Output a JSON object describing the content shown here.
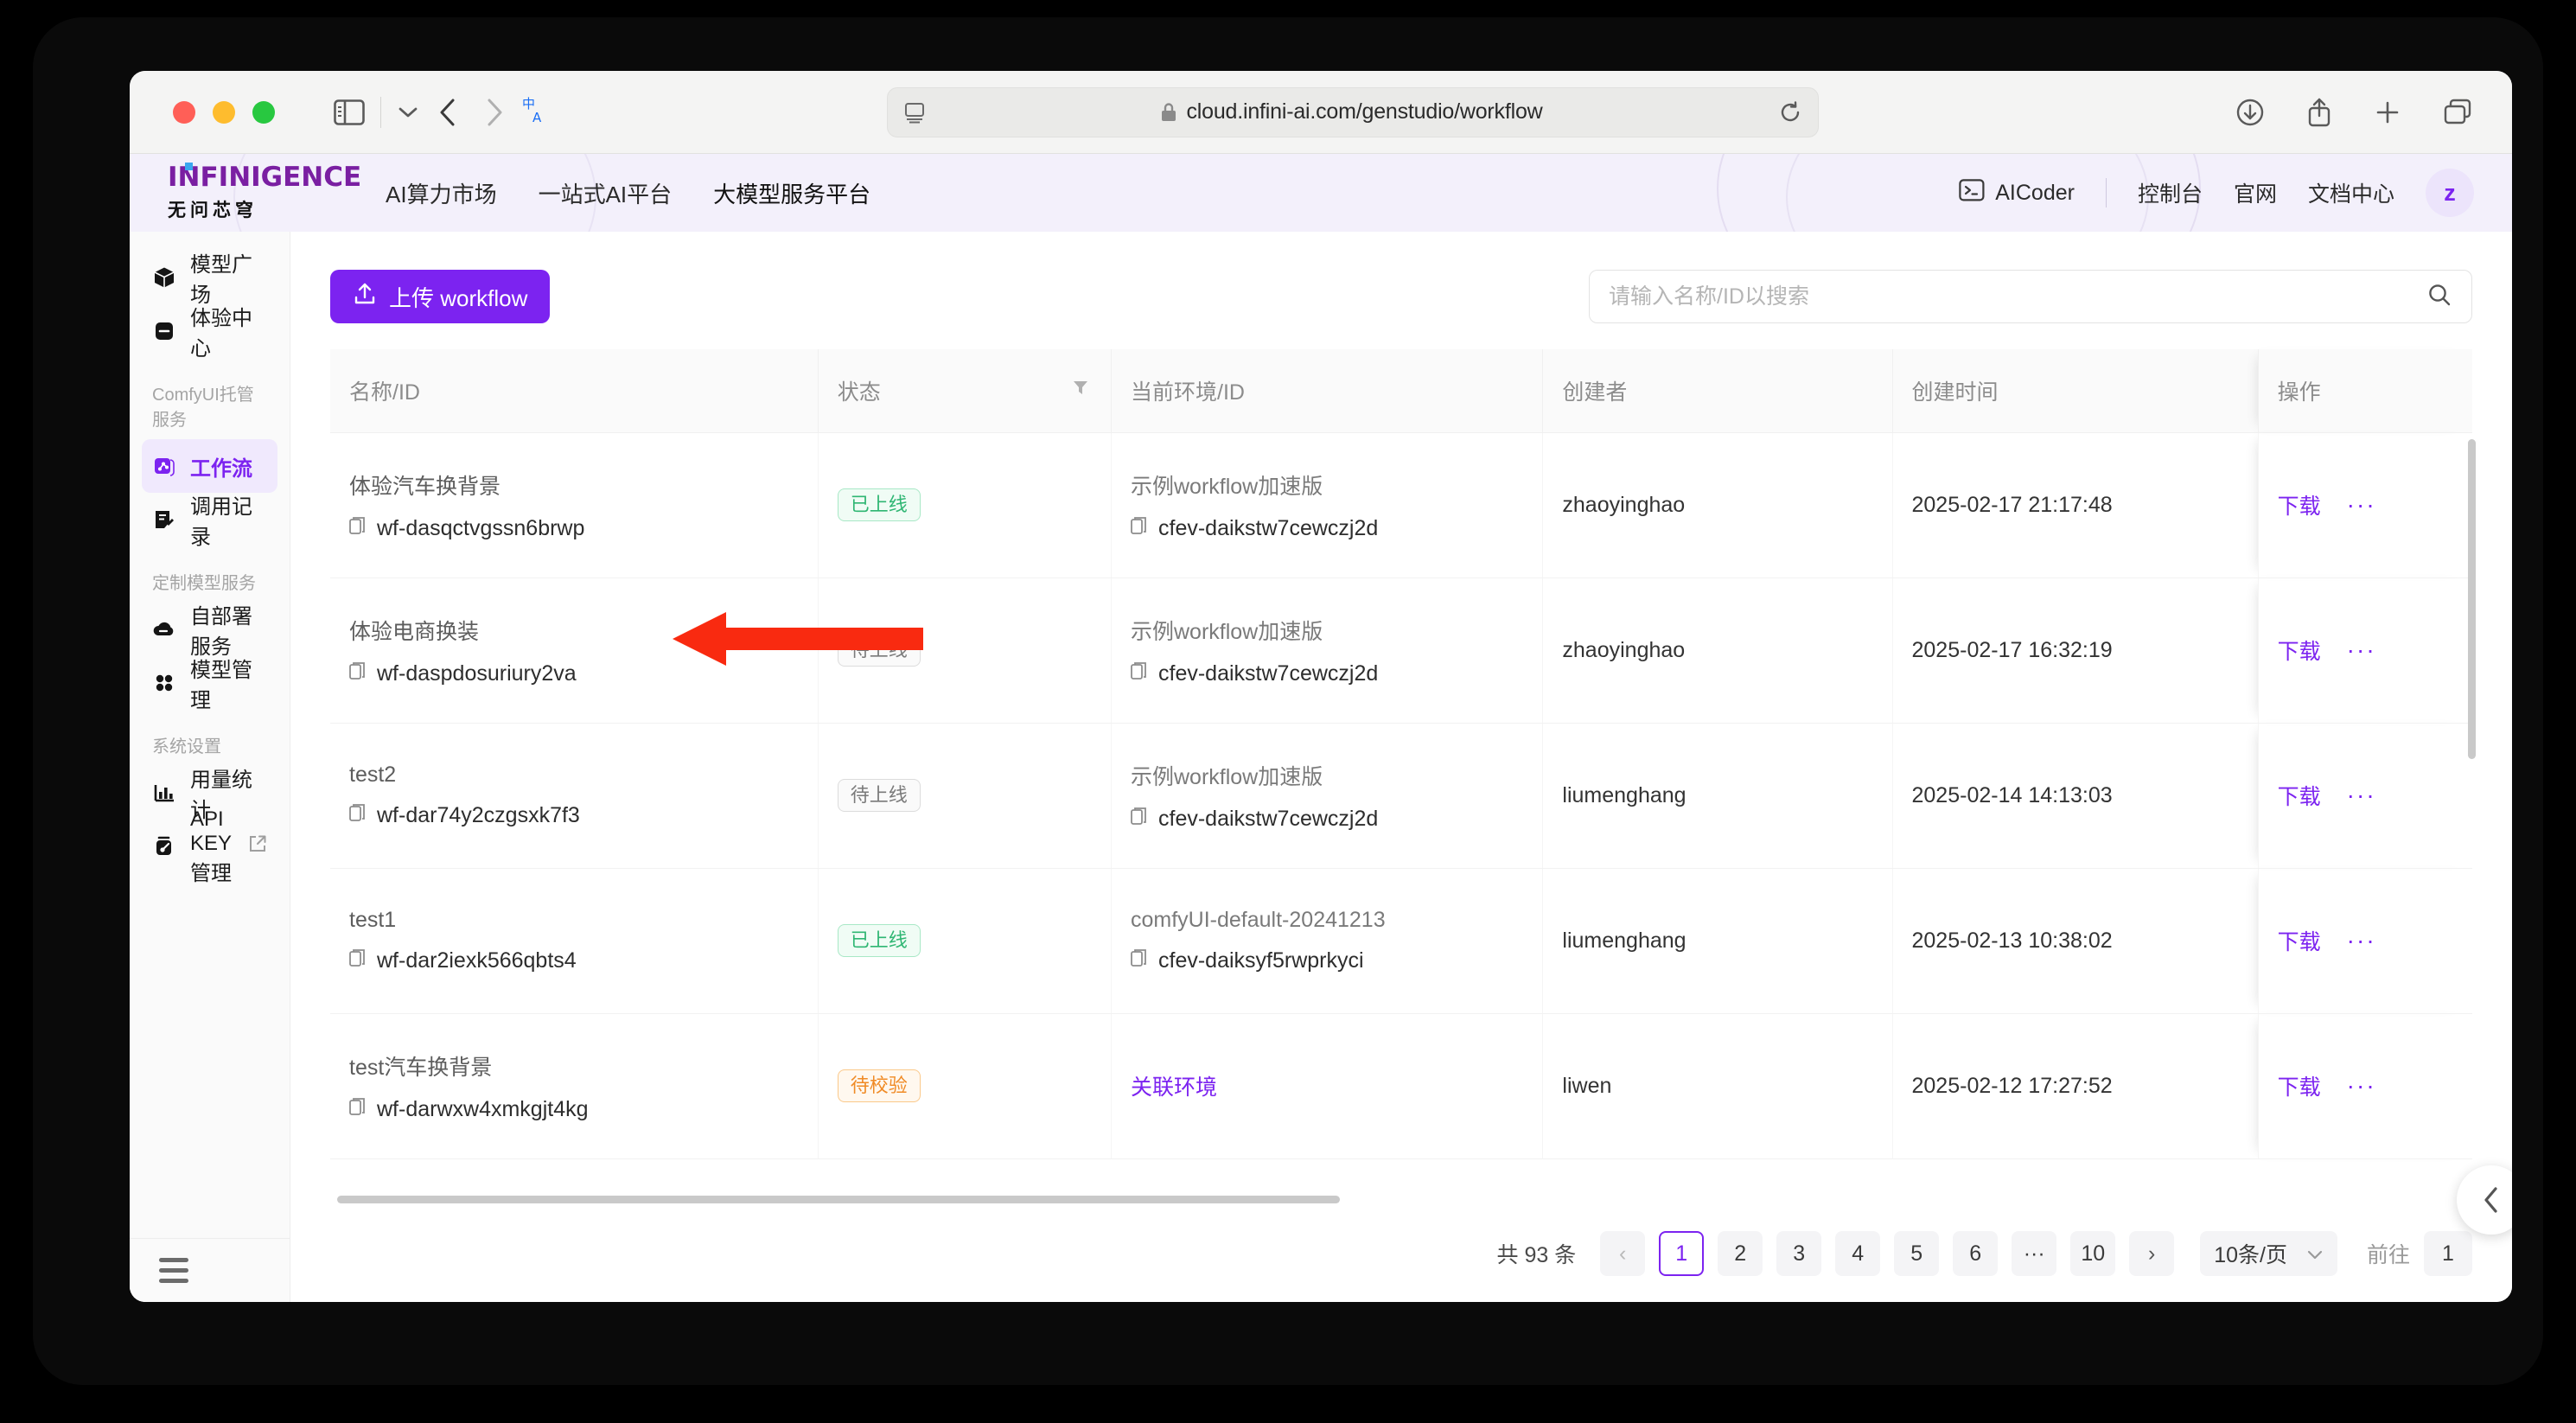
{
  "browser": {
    "url": "cloud.infini-ai.com/genstudio/workflow",
    "icons": {
      "sidebar": "sidebar-toggle-icon",
      "chevron_down": "chevron-down-icon",
      "back": "back-arrow-icon",
      "forward": "forward-arrow-icon",
      "translate": "translate-icon",
      "reader": "reader-view-icon",
      "lock": "lock-icon",
      "reload": "reload-icon",
      "downloads": "downloads-icon",
      "share": "share-icon",
      "new_tab": "plus-icon",
      "tab_overview": "tab-overview-icon"
    }
  },
  "header": {
    "logo_main": "INFINIGENCE",
    "logo_sub": "无问芯穹",
    "nav": [
      {
        "label": "AI算力市场",
        "active": false
      },
      {
        "label": "一站式AI平台",
        "active": false
      },
      {
        "label": "大模型服务平台",
        "active": true
      }
    ],
    "aicoder_label": "AICoder",
    "links": [
      "控制台",
      "官网",
      "文档中心"
    ],
    "avatar_initial": "z",
    "accent_color": "#7c23f0"
  },
  "sidebar": {
    "items": [
      {
        "label": "模型广场",
        "icon": "cube-icon",
        "type": "item",
        "active": false
      },
      {
        "label": "体验中心",
        "icon": "chat-box-icon",
        "type": "item",
        "active": false
      },
      {
        "label": "ComfyUI托管服务",
        "type": "group"
      },
      {
        "label": "工作流",
        "icon": "workflow-icon",
        "type": "item",
        "active": true
      },
      {
        "label": "调用记录",
        "icon": "record-icon",
        "type": "item",
        "active": false
      },
      {
        "label": "定制模型服务",
        "type": "group"
      },
      {
        "label": "自部署服务",
        "icon": "cloud-icon",
        "type": "item",
        "active": false
      },
      {
        "label": "模型管理",
        "icon": "grid-icon",
        "type": "item",
        "active": false
      },
      {
        "label": "系统设置",
        "type": "group"
      },
      {
        "label": "用量统计",
        "icon": "bar-chart-icon",
        "type": "item",
        "active": false
      },
      {
        "label": "API KEY管理",
        "icon": "key-icon",
        "type": "item",
        "active": false,
        "external": true
      }
    ],
    "menu_toggle": "hamburger-menu-icon"
  },
  "toolbar": {
    "upload_label": "上传 workflow",
    "upload_icon": "upload-icon",
    "search_placeholder": "请输入名称/ID以搜索",
    "search_value": "",
    "search_icon": "search-icon"
  },
  "table": {
    "columns": [
      {
        "key": "name",
        "label": "名称/ID"
      },
      {
        "key": "status",
        "label": "状态",
        "filter": true
      },
      {
        "key": "env",
        "label": "当前环境/ID"
      },
      {
        "key": "creator",
        "label": "创建者"
      },
      {
        "key": "created",
        "label": "创建时间"
      },
      {
        "key": "actions",
        "label": "操作"
      }
    ],
    "rows": [
      {
        "name": "体验汽车换背景",
        "id": "wf-dasqctvgssn6brwp",
        "status": "已上线",
        "status_type": "online",
        "env": "示例workflow加速版",
        "env_id": "cfev-daikstw7cewczj2d",
        "env_link": false,
        "creator": "zhaoyinghao",
        "created": "2025-02-17 21:17:48",
        "download": "下载",
        "more": "···"
      },
      {
        "name": "体验电商换装",
        "id": "wf-daspdosuriury2va",
        "status": "待上线",
        "status_type": "pending",
        "env": "示例workflow加速版",
        "env_id": "cfev-daikstw7cewczj2d",
        "env_link": false,
        "creator": "zhaoyinghao",
        "created": "2025-02-17 16:32:19",
        "download": "下载",
        "more": "···"
      },
      {
        "name": "test2",
        "id": "wf-dar74y2czgsxk7f3",
        "status": "待上线",
        "status_type": "pending",
        "env": "示例workflow加速版",
        "env_id": "cfev-daikstw7cewczj2d",
        "env_link": false,
        "creator": "liumenghang",
        "created": "2025-02-14 14:13:03",
        "download": "下载",
        "more": "···"
      },
      {
        "name": "test1",
        "id": "wf-dar2iexk566qbts4",
        "status": "已上线",
        "status_type": "online",
        "env": "comfyUI-default-20241213",
        "env_id": "cfev-daiksyf5rwprkyci",
        "env_link": false,
        "creator": "liumenghang",
        "created": "2025-02-13 10:38:02",
        "download": "下载",
        "more": "···"
      },
      {
        "name": "test汽车换背景",
        "id": "wf-darwxw4xmkgjt4kg",
        "status": "待校验",
        "status_type": "verify",
        "env": "关联环境",
        "env_id": "",
        "env_link": true,
        "creator": "liwen",
        "created": "2025-02-12 17:27:52",
        "download": "下载",
        "more": "···"
      }
    ]
  },
  "pagination": {
    "total_label": "共 93 条",
    "prev": "‹",
    "next": "›",
    "pages": [
      "1",
      "2",
      "3",
      "4",
      "5",
      "6",
      "···",
      "10"
    ],
    "current": "1",
    "page_size_label": "10条/页",
    "goto_label": "前往",
    "goto_value": "1"
  },
  "annotation": {
    "arrow_color": "#f92a10",
    "points_to": "体验汽车换背景"
  },
  "fab": {
    "icon": "chevron-left-icon"
  }
}
